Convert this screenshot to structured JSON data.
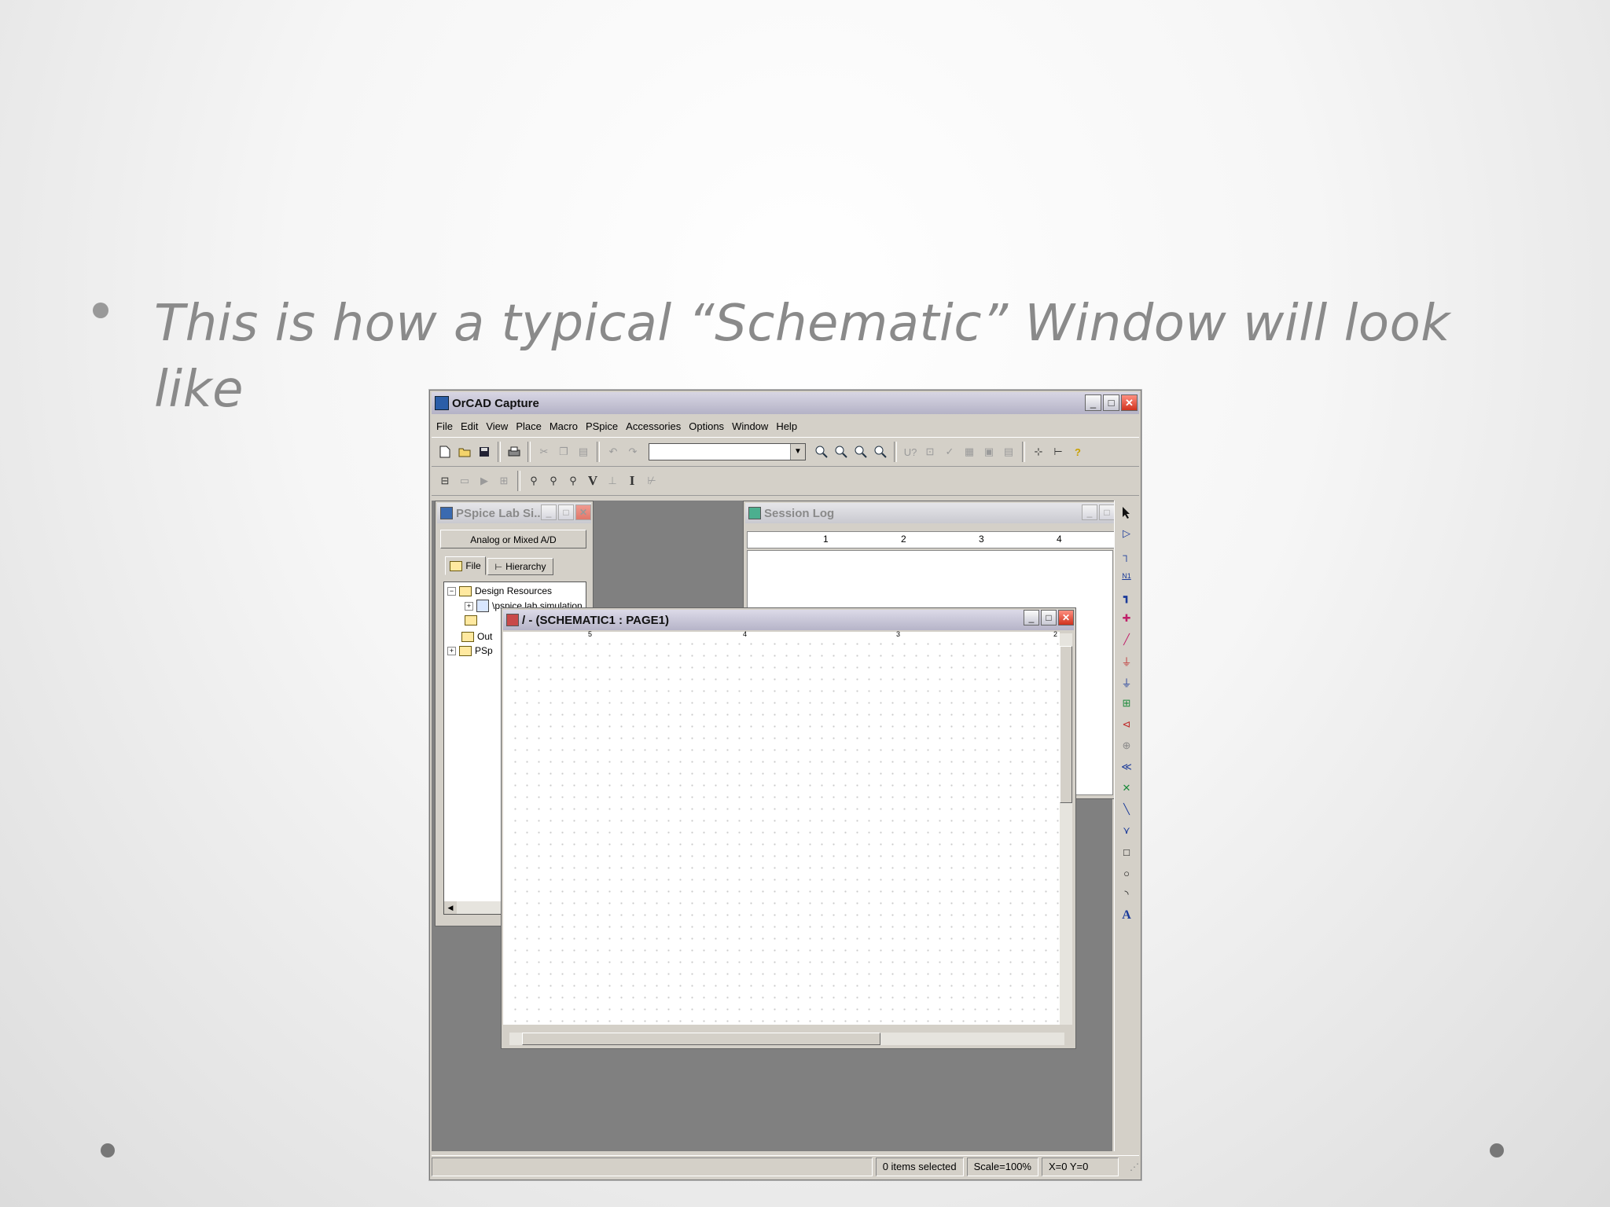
{
  "slide": {
    "bullet_text": "This is how a typical “Schematic” Window will look like",
    "colors": {
      "text": "#8a8a8a",
      "bullet": "#999999",
      "page_dot": "#777777"
    }
  },
  "app": {
    "title": "OrCAD Capture",
    "window_controls": {
      "minimize": "_",
      "maximize": "□",
      "close": "✕"
    },
    "menu": [
      "File",
      "Edit",
      "View",
      "Place",
      "Macro",
      "PSpice",
      "Accessories",
      "Options",
      "Window",
      "Help"
    ],
    "toolbar1_icons": [
      "new-icon",
      "open-icon",
      "save-icon",
      "print-icon",
      "cut-icon",
      "copy-icon",
      "paste-icon",
      "undo-icon",
      "redo-icon",
      "zoom-in-icon",
      "zoom-out-icon",
      "zoom-area-icon",
      "zoom-all-icon",
      "help-icon"
    ],
    "toolbar2_glyphs": {
      "voltage_marker": "V",
      "current_marker": "I"
    },
    "palette_icons": [
      "select-icon",
      "part-icon",
      "wire-icon",
      "net-alias-icon",
      "bus-icon",
      "junction-icon",
      "bus-entry-icon",
      "power-icon",
      "ground-icon",
      "hierarchical-block-icon",
      "port-icon",
      "pin-icon",
      "off-page-icon",
      "no-connect-icon",
      "line-icon",
      "polyline-icon",
      "rectangle-icon",
      "ellipse-icon",
      "arc-icon",
      "text-icon"
    ],
    "palette_text": "A",
    "status": {
      "selection": "0 items selected",
      "scale": "Scale=100%",
      "coords": "X=0  Y=0"
    }
  },
  "project_window": {
    "title": "PSpice Lab Si...",
    "header_button": "Analog or Mixed A/D",
    "tabs": [
      "File",
      "Hierarchy"
    ],
    "tree": [
      "Design Resources",
      "\\pspice lab simulation",
      "Out",
      "PSp"
    ],
    "expanders": {
      "collapse": "−",
      "expand": "+"
    }
  },
  "session_log": {
    "title": "Session Log",
    "ruler_marks": [
      "1",
      "2",
      "3",
      "4"
    ]
  },
  "schematic": {
    "title": "/ - (SCHEMATIC1 : PAGE1)",
    "border_marks": [
      "5",
      "4",
      "3",
      "2"
    ]
  }
}
